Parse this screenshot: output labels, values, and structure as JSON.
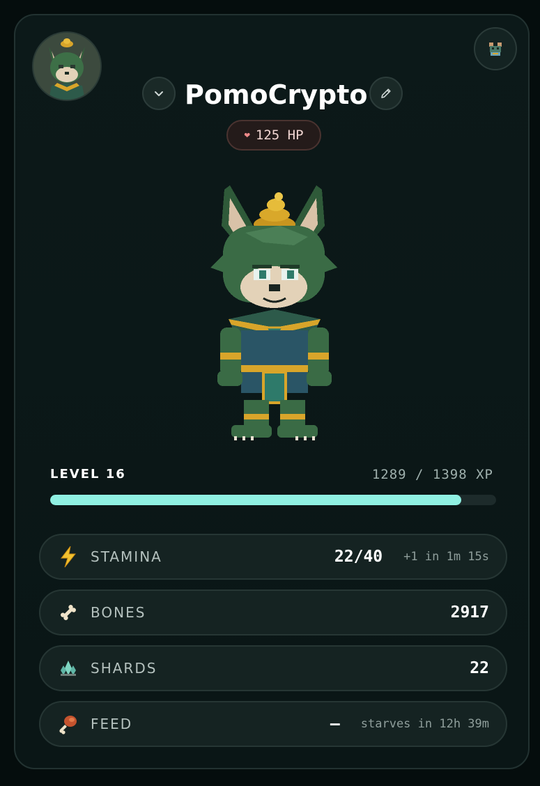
{
  "profile": {
    "name": "PomoCrypto",
    "hp": "125 HP"
  },
  "progress": {
    "level_label": "LEVEL 16",
    "xp_text": "1289 / 1398 XP",
    "xp_current": 1289,
    "xp_max": 1398
  },
  "stats": [
    {
      "label": "STAMINA",
      "value": "22/40",
      "sub": "+1 in 1m 15s",
      "icon": "lightning-icon"
    },
    {
      "label": "BONES",
      "value": "2917",
      "sub": "",
      "icon": "bone-icon"
    },
    {
      "label": "SHARDS",
      "value": "22",
      "sub": "",
      "icon": "crystal-shard-icon"
    },
    {
      "label": "FEED",
      "value": "–",
      "sub": "starves in 12h 39m",
      "icon": "meat-drumstick-icon"
    }
  ],
  "colors": {
    "accent": "#8ff0e2",
    "background": "#0b1717",
    "fur": "#3b6b45",
    "gold": "#d8a52a"
  }
}
